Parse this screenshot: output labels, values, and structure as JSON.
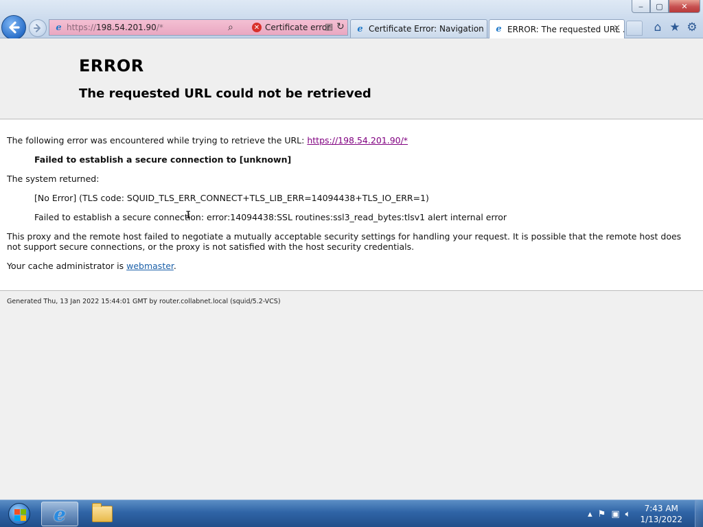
{
  "browser": {
    "window_controls": {
      "minimize": "‒",
      "maximize": "▢",
      "close": "✕"
    },
    "address_bar": {
      "scheme": "https://",
      "host": "198.54.201.90",
      "rest": "/*",
      "security_label": "Certificate error"
    },
    "tabs": [
      {
        "label": "Certificate Error: Navigation Bl...",
        "active": false
      },
      {
        "label": "ERROR: The requested URL ...",
        "active": true
      }
    ],
    "icons": [
      "back-icon",
      "forward-icon",
      "search-icon",
      "certificate-error-icon",
      "compat-view-icon",
      "refresh-icon",
      "home-icon",
      "favorites-star-icon",
      "gear-icon"
    ]
  },
  "page": {
    "title": "ERROR",
    "subtitle": "The requested URL could not be retrieved",
    "intro_text": "The following error was encountered while trying to retrieve the URL: ",
    "url_link": "https://198.54.201.90/*",
    "failed_connection": "Failed to establish a secure connection to [unknown]",
    "system_returned_label": "The system returned:",
    "system_error_1": "[No Error] (TLS code: SQUID_TLS_ERR_CONNECT+TLS_LIB_ERR=14094438+TLS_IO_ERR=1)",
    "system_error_2": "Failed to establish a secure connection: error:14094438:SSL routines:ssl3_read_bytes:tlsv1 alert internal error",
    "explanation": "This proxy and the remote host failed to negotiate a mutually acceptable security settings for handling your request. It is possible that the remote host does not support secure connections, or the proxy is not satisfied with the host security credentials.",
    "admin_prefix": "Your cache administrator is ",
    "admin_link": "webmaster",
    "admin_suffix": ".",
    "footer": "Generated Thu, 13 Jan 2022 15:44:01 GMT by router.collabnet.local (squid/5.2-VCS)"
  },
  "taskbar": {
    "clock_time": "7:43 AM",
    "clock_date": "1/13/2022",
    "tray_icons": [
      "show-hidden-icons",
      "action-center-flag-icon",
      "network-icon",
      "volume-icon"
    ]
  },
  "colors": {
    "address_bar_error": "#e9a7c1",
    "visited_link": "#800080",
    "link": "#1a5fa8",
    "taskbar": "#2f64a6"
  }
}
